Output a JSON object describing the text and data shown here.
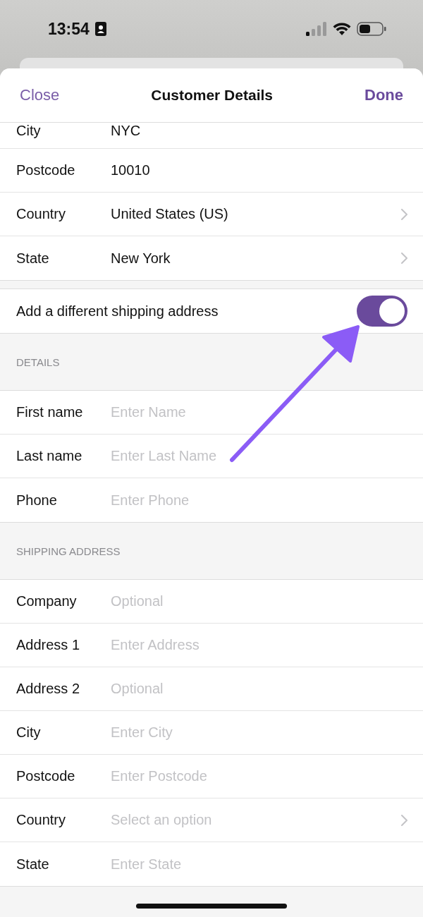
{
  "status_bar": {
    "time": "13:54"
  },
  "nav": {
    "close": "Close",
    "title": "Customer Details",
    "done": "Done"
  },
  "billing_rows": [
    {
      "label": "City",
      "value": "NYC",
      "disclosure": false,
      "cut": true
    },
    {
      "label": "Postcode",
      "value": "10010",
      "disclosure": false,
      "cut": false
    },
    {
      "label": "Country",
      "value": "United States (US)",
      "disclosure": true,
      "cut": false
    },
    {
      "label": "State",
      "value": "New York",
      "disclosure": true,
      "cut": false
    }
  ],
  "shipping_toggle": {
    "label": "Add a different shipping address",
    "on": true
  },
  "sections": [
    {
      "header": "DETAILS",
      "rows": [
        {
          "label": "First name",
          "placeholder": "Enter Name",
          "disclosure": false
        },
        {
          "label": "Last name",
          "placeholder": "Enter Last Name",
          "disclosure": false
        },
        {
          "label": "Phone",
          "placeholder": "Enter Phone",
          "disclosure": false
        }
      ]
    },
    {
      "header": "SHIPPING ADDRESS",
      "rows": [
        {
          "label": "Company",
          "placeholder": "Optional",
          "disclosure": false
        },
        {
          "label": "Address 1",
          "placeholder": "Enter Address",
          "disclosure": false
        },
        {
          "label": "Address 2",
          "placeholder": "Optional",
          "disclosure": false
        },
        {
          "label": "City",
          "placeholder": "Enter City",
          "disclosure": false
        },
        {
          "label": "Postcode",
          "placeholder": "Enter Postcode",
          "disclosure": false
        },
        {
          "label": "Country",
          "placeholder": "Select an option",
          "disclosure": true
        },
        {
          "label": "State",
          "placeholder": "Enter State",
          "disclosure": false
        }
      ]
    }
  ]
}
